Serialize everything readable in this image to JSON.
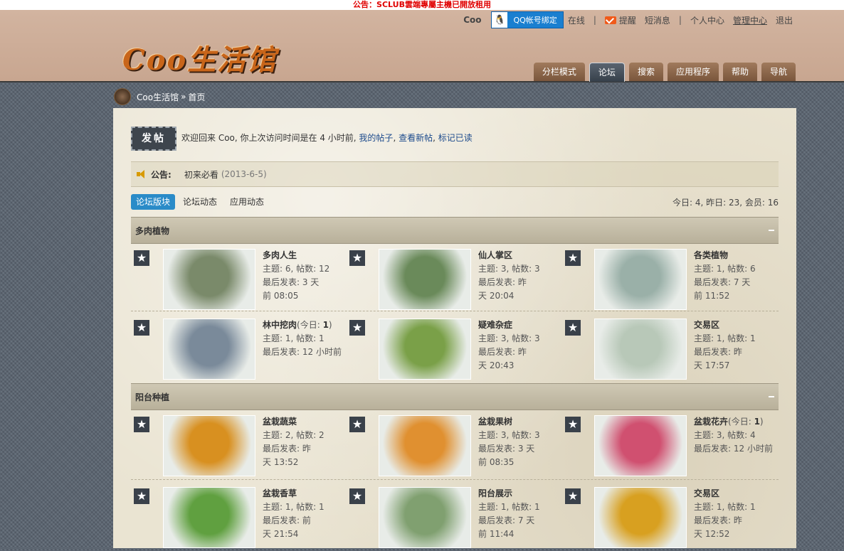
{
  "notice": "公告：SCLUB雲端專屬主機已開放租用",
  "userbar": {
    "username": "Coo",
    "qq_bind": "QQ帐号绑定",
    "online": "在线",
    "remind": "提醒",
    "messages": "短消息",
    "profile": "个人中心",
    "admin": "管理中心",
    "logout": "退出",
    "sep": "|"
  },
  "logo_text": "Coo生活馆",
  "nav": [
    "分栏模式",
    "论坛",
    "搜索",
    "应用程序",
    "帮助",
    "导航"
  ],
  "breadcrumb": {
    "home": "Coo生活馆",
    "sep": "»",
    "current": "首页"
  },
  "post_button": "发帖",
  "welcome": {
    "text": "欢迎回来 Coo, 你上次访问时间是在 4 小时前,",
    "my_posts": "我的帖子",
    "new_posts": "查看新帖",
    "mark_read": "标记已读",
    "comma": ","
  },
  "announcement": {
    "label": "公告:",
    "text": "初来必看",
    "date": "(2013-6-5)"
  },
  "tabs": [
    "论坛版块",
    "论坛动态",
    "应用动态"
  ],
  "stats": "今日: 4, 昨日: 23, 会员: 16",
  "categories": [
    {
      "title": "多肉植物",
      "forums": [
        {
          "name": "多肉人生",
          "today": "",
          "line1": "主题: 6, 帖数: 12",
          "line2": "最后发表: 3 天",
          "line3": "前 08:05"
        },
        {
          "name": "仙人掌区",
          "today": "",
          "line1": "主题: 3, 帖数: 3",
          "line2": "最后发表: 昨",
          "line3": "天 20:04"
        },
        {
          "name": "各类植物",
          "today": "",
          "line1": "主题: 1, 帖数: 6",
          "line2": "最后发表: 7 天",
          "line3": "前 11:52"
        },
        {
          "name": "林中挖肉",
          "today": "1",
          "line1": "主题: 1, 帖数: 1",
          "line2": "最后发表: 12 小时前",
          "line3": ""
        },
        {
          "name": "疑难杂症",
          "today": "",
          "line1": "主题: 3, 帖数: 3",
          "line2": "最后发表: 昨",
          "line3": "天 20:43"
        },
        {
          "name": "交易区",
          "today": "",
          "line1": "主题: 1, 帖数: 1",
          "line2": "最后发表: 昨",
          "line3": "天 17:57"
        }
      ]
    },
    {
      "title": "阳台种植",
      "forums": [
        {
          "name": "盆栽蔬菜",
          "today": "",
          "line1": "主题: 2, 帖数: 2",
          "line2": "最后发表: 昨",
          "line3": "天 13:52"
        },
        {
          "name": "盆栽果树",
          "today": "",
          "line1": "主题: 3, 帖数: 3",
          "line2": "最后发表: 3 天",
          "line3": "前 08:35"
        },
        {
          "name": "盆栽花卉",
          "today": "1",
          "line1": "主题: 3, 帖数: 4",
          "line2": "最后发表: 12 小时前",
          "line3": ""
        },
        {
          "name": "盆栽香草",
          "today": "",
          "line1": "主题: 1, 帖数: 1",
          "line2": "最后发表: 前",
          "line3": "天 21:54"
        },
        {
          "name": "阳台展示",
          "today": "",
          "line1": "主题: 1, 帖数: 1",
          "line2": "最后发表: 7 天",
          "line3": "前 11:44"
        },
        {
          "name": "交易区",
          "today": "",
          "line1": "主题: 1, 帖数: 1",
          "line2": "最后发表: 昨",
          "line3": "天 12:52"
        }
      ]
    }
  ],
  "today_prefix": "(今日: ",
  "today_suffix": ")",
  "star_glyph": "★",
  "thumb_colors": [
    "#7a8a6a",
    "#6a8a5a",
    "#9ab0a8",
    "#7a8a9a",
    "#7aa048",
    "#b8c8b8",
    "#d89020",
    "#e09030",
    "#d05070",
    "#60a040",
    "#80a070",
    "#d8a020"
  ]
}
